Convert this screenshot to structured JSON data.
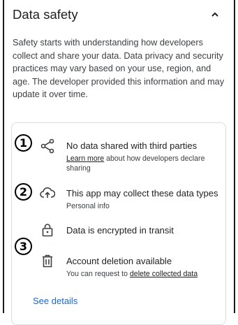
{
  "section": {
    "title": "Data safety",
    "intro": "Safety starts with understanding how developers collect and share your data. Data privacy and security practices may vary based on your use, region, and age. The developer provided this information and may update it over time."
  },
  "items": [
    {
      "icon": "share-icon",
      "title": "No data shared with third parties",
      "subtitle_link": "Learn more",
      "subtitle_after": " about how developers declare sharing"
    },
    {
      "icon": "cloud-upload-icon",
      "title": "This app may collect these data types",
      "subtitle": "Personal info"
    },
    {
      "icon": "lock-icon",
      "title": "Data is encrypted in transit"
    },
    {
      "icon": "trash-icon",
      "title": "Account deletion available",
      "subtitle_before": "You can request to ",
      "subtitle_link": "delete collected data"
    }
  ],
  "badges": [
    "1",
    "2",
    "3"
  ],
  "footer": {
    "see_details": "See details"
  },
  "colors": {
    "link": "#1967d2",
    "border": "#dadce0",
    "text": "#202124"
  }
}
